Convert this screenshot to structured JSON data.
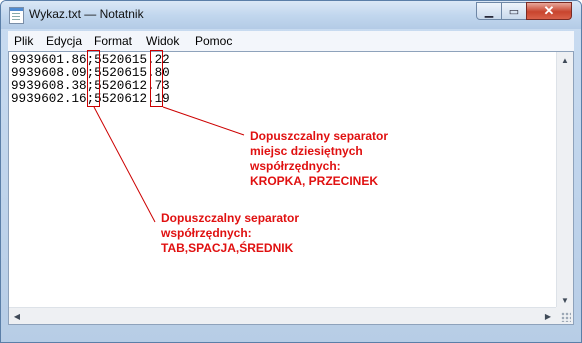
{
  "window": {
    "title": "Wykaz.txt — Notatnik"
  },
  "controls": {
    "minimize": "▁",
    "maximize": "▭",
    "close": "✕"
  },
  "menu": [
    "Plik",
    "Edycja",
    "Format",
    "Widok",
    "Pomoc"
  ],
  "document": {
    "lines": [
      "9939601.86;5520615.22",
      "9939608.09;5520615.80",
      "9939608.38;5520612.73",
      "9939602.16;5520612.19"
    ]
  },
  "annotations": {
    "decimal_separator": "Dopuszczalny separator\nmiejsc dziesiętnych\nwspółrzędnych:\nKROPKA, PRZECINEK",
    "coordinate_separator": "Dopuszczalny separator\nwspółrzędnych:\nTAB,SPACJA,ŚREDNIK"
  },
  "colors": {
    "annotation": "#e01010",
    "titlebar": "#c2d7ee",
    "close_button": "#c8442e"
  }
}
